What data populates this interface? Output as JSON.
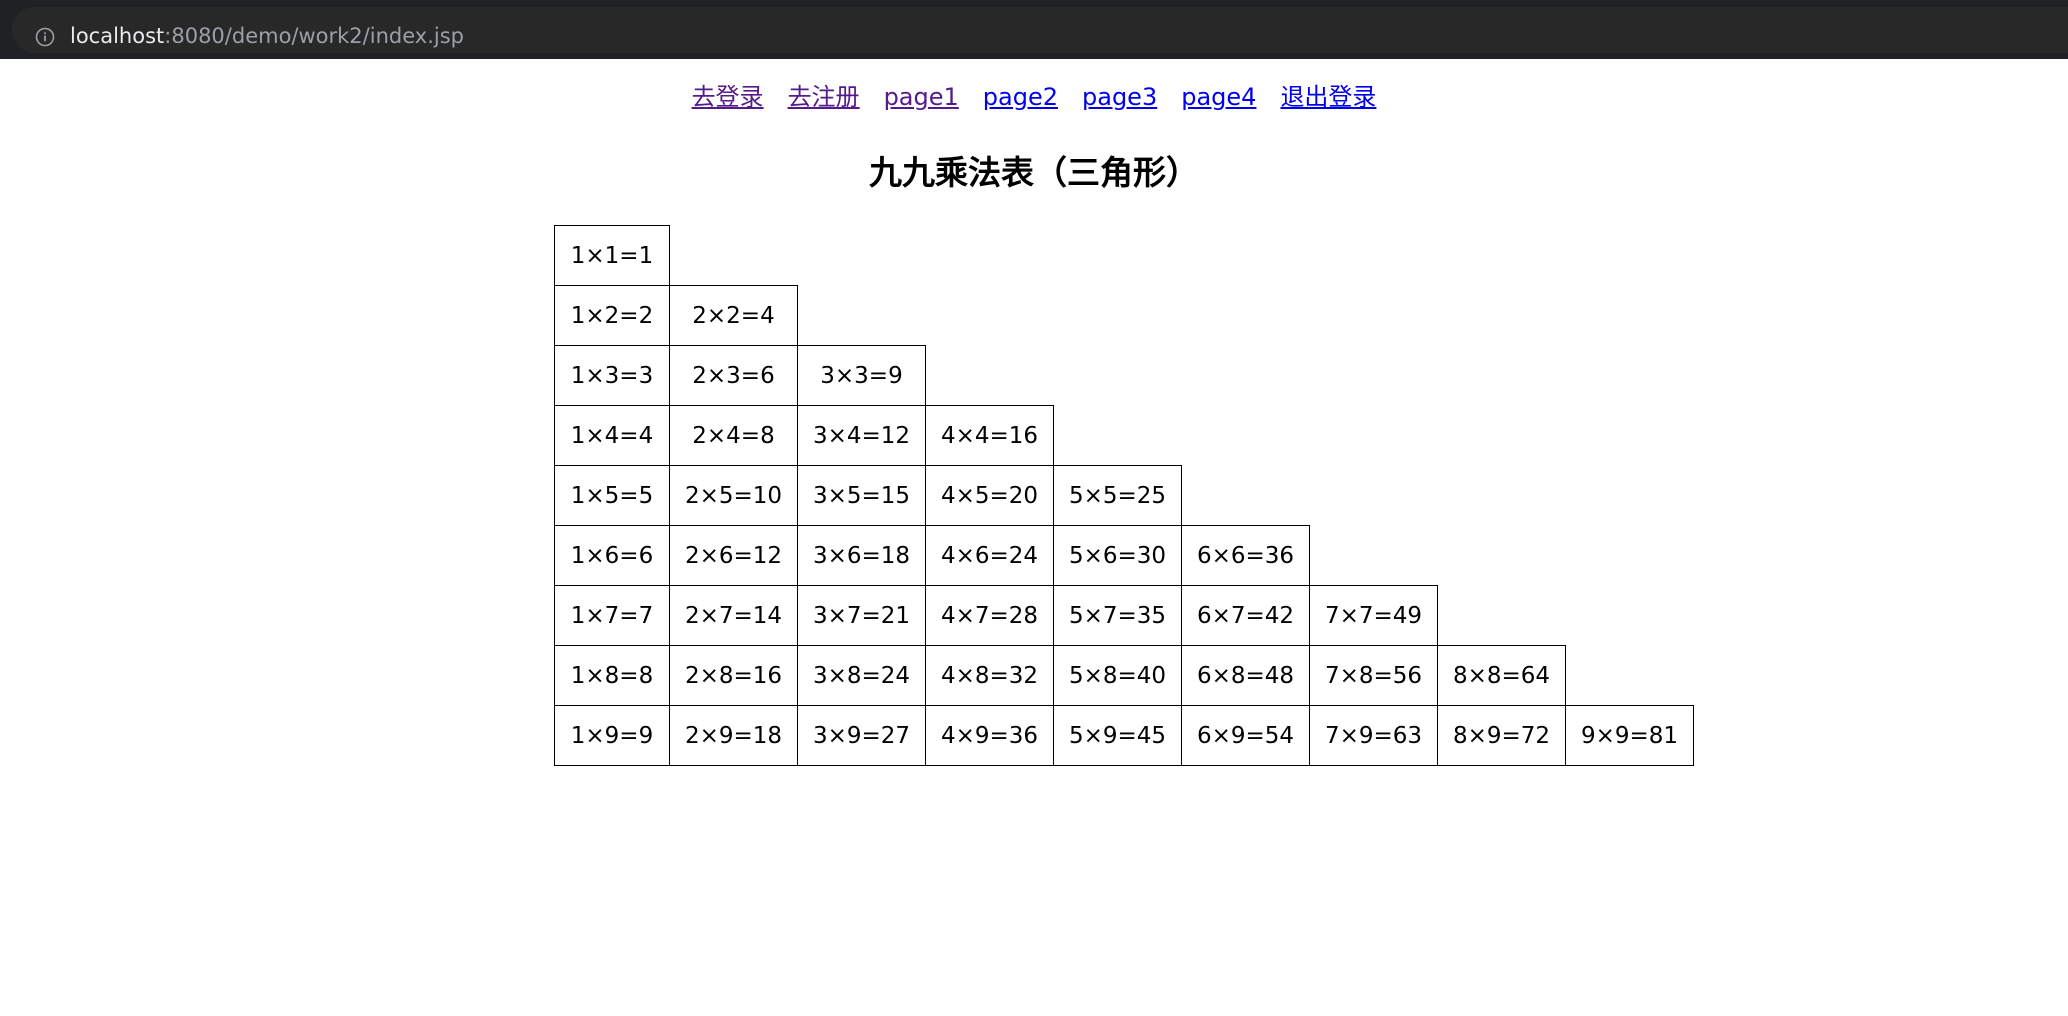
{
  "browser": {
    "url_host": "localhost",
    "url_rest": ":8080/demo/work2/index.jsp"
  },
  "nav": {
    "links": [
      {
        "label": "去登录",
        "visited": true
      },
      {
        "label": "去注册",
        "visited": true
      },
      {
        "label": "page1",
        "visited": true
      },
      {
        "label": "page2",
        "visited": false
      },
      {
        "label": "page3",
        "visited": false
      },
      {
        "label": "page4",
        "visited": false
      },
      {
        "label": "退出登录",
        "visited": false
      }
    ]
  },
  "page": {
    "title": "九九乘法表（三角形）"
  },
  "table": {
    "rows": [
      [
        "1×1=1"
      ],
      [
        "1×2=2",
        "2×2=4"
      ],
      [
        "1×3=3",
        "2×3=6",
        "3×3=9"
      ],
      [
        "1×4=4",
        "2×4=8",
        "3×4=12",
        "4×4=16"
      ],
      [
        "1×5=5",
        "2×5=10",
        "3×5=15",
        "4×5=20",
        "5×5=25"
      ],
      [
        "1×6=6",
        "2×6=12",
        "3×6=18",
        "4×6=24",
        "5×6=30",
        "6×6=36"
      ],
      [
        "1×7=7",
        "2×7=14",
        "3×7=21",
        "4×7=28",
        "5×7=35",
        "6×7=42",
        "7×7=49"
      ],
      [
        "1×8=8",
        "2×8=16",
        "3×8=24",
        "4×8=32",
        "5×8=40",
        "6×8=48",
        "7×8=56",
        "8×8=64"
      ],
      [
        "1×9=9",
        "2×9=18",
        "3×9=27",
        "4×9=36",
        "5×9=45",
        "6×9=54",
        "7×9=63",
        "8×9=72",
        "9×9=81"
      ]
    ]
  }
}
